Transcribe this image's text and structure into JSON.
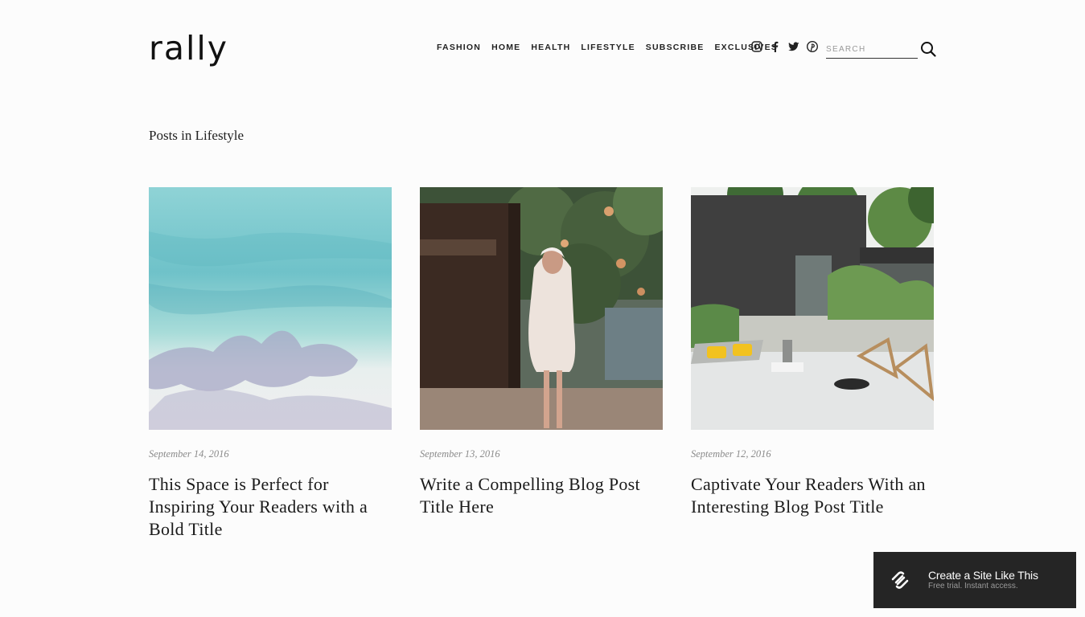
{
  "brand": {
    "logo": "rally"
  },
  "nav": [
    "FASHION",
    "HOME",
    "HEALTH",
    "LIFESTYLE",
    "SUBSCRIBE",
    "EXCLUSIVES"
  ],
  "social": [
    "instagram-icon",
    "facebook-icon",
    "twitter-icon",
    "pinterest-icon"
  ],
  "search": {
    "placeholder": "SEARCH",
    "value": ""
  },
  "section": {
    "title": "Posts in Lifestyle"
  },
  "posts": [
    {
      "date": "September 14, 2016",
      "title": "This Space is Perfect for Inspiring Your Readers with a Bold Title",
      "image": "beach-water-image"
    },
    {
      "date": "September 13, 2016",
      "title": "Write a Compelling Blog Post Title Here",
      "image": "woman-by-fence-image"
    },
    {
      "date": "September 12, 2016",
      "title": "Captivate Your Readers With an Interesting Blog Post Title",
      "image": "modern-house-patio-image"
    }
  ],
  "promo": {
    "title": "Create a Site Like This",
    "subtitle": "Free trial. Instant access."
  }
}
